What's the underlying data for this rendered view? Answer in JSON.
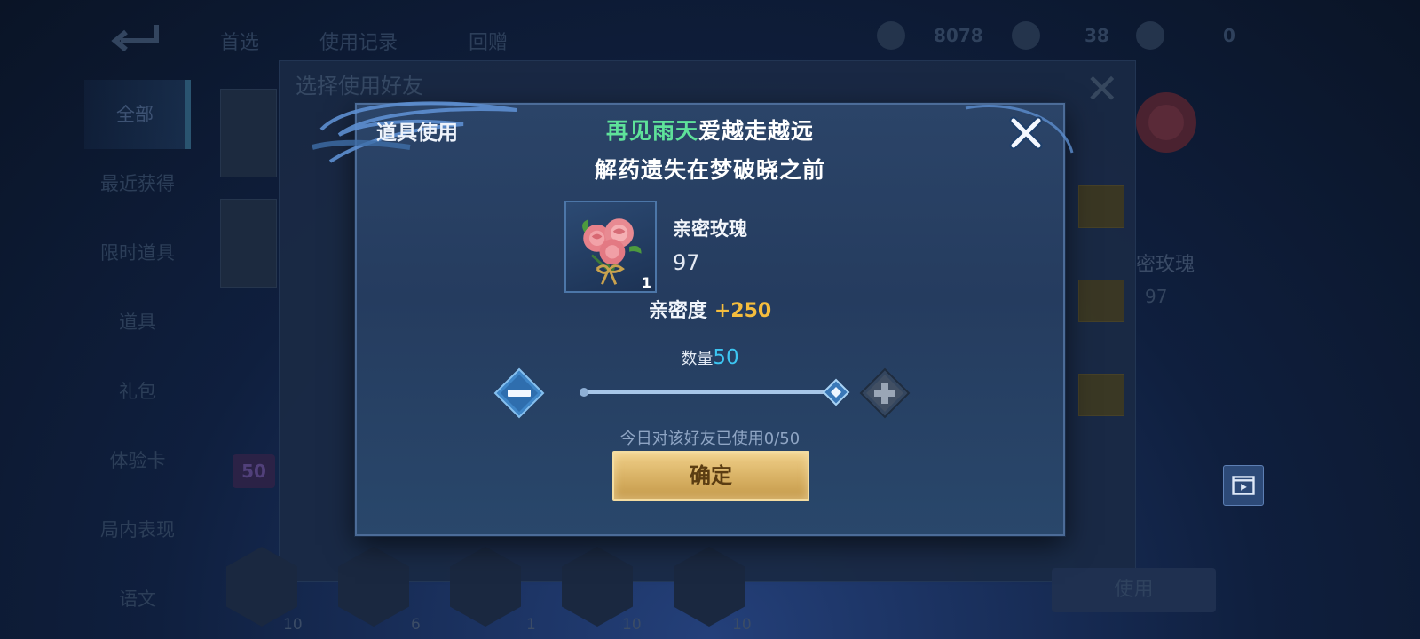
{
  "background": {
    "top_labels": [
      "首选",
      "使用记录",
      "回赠"
    ],
    "currencies": [
      "8078",
      "38",
      "0"
    ],
    "side_nav": [
      "全部",
      "最近获得",
      "限时道具",
      "道具",
      "礼包",
      "体验卡",
      "局内表现",
      "语文"
    ],
    "panel_title": "选择使用好友",
    "item_label": "密玫瑰",
    "item_num": "97",
    "badge": "50",
    "hex_counts": [
      "10",
      "6",
      "1",
      "10",
      "10"
    ],
    "use_button": "使用"
  },
  "dialog": {
    "title": "道具使用",
    "lyric_line1_highlight": "再见雨天",
    "lyric_line1_rest": "爱越走越远",
    "lyric_line2": "解药遗失在梦破晓之前",
    "item": {
      "name": "亲密玫瑰",
      "owned": "97",
      "slot_count": "1",
      "icon": "rose-bouquet-icon"
    },
    "intimacy": {
      "label": "亲密度",
      "value": "+250"
    },
    "quantity": {
      "label": "数量",
      "value": "50",
      "slider_fraction": 1.0
    },
    "usage_text": "今日对该好友已使用0/50",
    "confirm_label": "确定"
  },
  "colors": {
    "highlight_green": "#5ee29a",
    "intimacy_gold": "#f5bd3d",
    "quantity_cyan": "#3cc6f2",
    "confirm_gold": "#d8b164"
  }
}
